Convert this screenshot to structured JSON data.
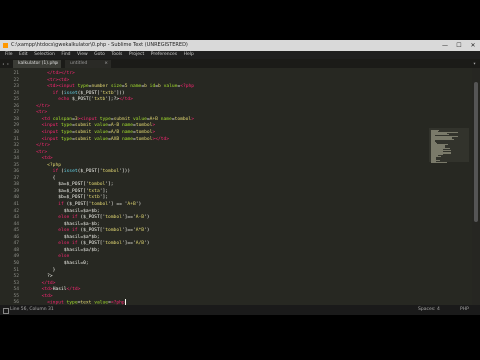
{
  "window": {
    "title": "C:\\xampp\\htdocs\\gwekalkulator\\0.php - Sublime Text (UNREGISTERED)",
    "minimize": "—",
    "maximize": "☐",
    "close": "✕"
  },
  "menu": [
    "File",
    "Edit",
    "Selection",
    "Find",
    "View",
    "Goto",
    "Tools",
    "Project",
    "Preferences",
    "Help"
  ],
  "tabs": [
    {
      "label": "kalkulator (1).php",
      "close": "×"
    },
    {
      "label": "untitled",
      "close": "×"
    }
  ],
  "tab_scroll": "◂ ▸",
  "tab_menu": "▾",
  "status": {
    "position": "Line 56, Column 31",
    "spaces": "Spaces: 4",
    "syntax": "PHP"
  },
  "code_lines": [
    {
      "n": "21",
      "parts": [
        [
          "t",
          "        "
        ],
        [
          "tag",
          "</td>"
        ],
        [
          "tag",
          "</tr>"
        ]
      ]
    },
    {
      "n": "22",
      "parts": [
        [
          "t",
          "        "
        ],
        [
          "tag",
          "<tr>"
        ],
        [
          "tag",
          "<td>"
        ]
      ]
    },
    {
      "n": "23",
      "parts": [
        [
          "t",
          "        "
        ],
        [
          "tag",
          "<td><input "
        ],
        [
          "attr",
          "type"
        ],
        [
          "t",
          "="
        ],
        [
          "str",
          "number"
        ],
        [
          "t",
          " "
        ],
        [
          "attr",
          "size"
        ],
        [
          "t",
          "="
        ],
        [
          "str",
          "5"
        ],
        [
          "t",
          " "
        ],
        [
          "attr",
          "name"
        ],
        [
          "t",
          "="
        ],
        [
          "str",
          "b"
        ],
        [
          "t",
          " "
        ],
        [
          "attr",
          "id"
        ],
        [
          "t",
          "="
        ],
        [
          "str",
          "b"
        ],
        [
          "t",
          " "
        ],
        [
          "attr",
          "value"
        ],
        [
          "t",
          "="
        ],
        [
          "tag",
          "<?php"
        ]
      ]
    },
    {
      "n": "24",
      "parts": [
        [
          "t",
          "          "
        ],
        [
          "kw",
          "if"
        ],
        [
          "t",
          " ("
        ],
        [
          "fn",
          "isset"
        ],
        [
          "t",
          "($_POST['"
        ],
        [
          "str",
          "txtb"
        ],
        [
          "t",
          "']))"
        ]
      ]
    },
    {
      "n": "25",
      "parts": [
        [
          "t",
          "            "
        ],
        [
          "kw",
          "echo"
        ],
        [
          "t",
          " $_POST['"
        ],
        [
          "str",
          "txtb"
        ],
        [
          "t",
          "'];?>"
        ],
        [
          "tag",
          "</td>"
        ]
      ]
    },
    {
      "n": "26",
      "parts": [
        [
          "t",
          "    "
        ],
        [
          "tag",
          "</tr>"
        ]
      ]
    },
    {
      "n": "27",
      "parts": [
        [
          "t",
          "    "
        ],
        [
          "tag",
          "<tr>"
        ]
      ]
    },
    {
      "n": "28",
      "parts": [
        [
          "t",
          "      "
        ],
        [
          "tag",
          "<td "
        ],
        [
          "attr",
          "colspan"
        ],
        [
          "t",
          "="
        ],
        [
          "str",
          "3"
        ],
        [
          "tag",
          "><input "
        ],
        [
          "attr",
          "type"
        ],
        [
          "t",
          "="
        ],
        [
          "str",
          "submit"
        ],
        [
          "t",
          " "
        ],
        [
          "attr",
          "value"
        ],
        [
          "t",
          "="
        ],
        [
          "str",
          "A+B"
        ],
        [
          "t",
          " "
        ],
        [
          "attr",
          "name"
        ],
        [
          "t",
          "="
        ],
        [
          "str",
          "tombol"
        ],
        [
          "tag",
          ">"
        ]
      ]
    },
    {
      "n": "29",
      "parts": [
        [
          "t",
          "      "
        ],
        [
          "tag",
          "<input "
        ],
        [
          "attr",
          "type"
        ],
        [
          "t",
          "="
        ],
        [
          "str",
          "submit"
        ],
        [
          "t",
          " "
        ],
        [
          "attr",
          "value"
        ],
        [
          "t",
          "="
        ],
        [
          "str",
          "A-B"
        ],
        [
          "t",
          " "
        ],
        [
          "attr",
          "name"
        ],
        [
          "t",
          "="
        ],
        [
          "str",
          "tombol"
        ],
        [
          "tag",
          ">"
        ]
      ]
    },
    {
      "n": "30",
      "parts": [
        [
          "t",
          "      "
        ],
        [
          "tag",
          "<input "
        ],
        [
          "attr",
          "type"
        ],
        [
          "t",
          "="
        ],
        [
          "str",
          "submit"
        ],
        [
          "t",
          " "
        ],
        [
          "attr",
          "value"
        ],
        [
          "t",
          "="
        ],
        [
          "str",
          "A/B"
        ],
        [
          "t",
          " "
        ],
        [
          "attr",
          "name"
        ],
        [
          "t",
          "="
        ],
        [
          "str",
          "tombol"
        ],
        [
          "tag",
          ">"
        ]
      ]
    },
    {
      "n": "31",
      "parts": [
        [
          "t",
          "      "
        ],
        [
          "tag",
          "<input "
        ],
        [
          "attr",
          "type"
        ],
        [
          "t",
          "="
        ],
        [
          "str",
          "submit"
        ],
        [
          "t",
          " "
        ],
        [
          "attr",
          "value"
        ],
        [
          "t",
          "="
        ],
        [
          "str",
          "AXB"
        ],
        [
          "t",
          " "
        ],
        [
          "attr",
          "name"
        ],
        [
          "t",
          "="
        ],
        [
          "str",
          "tombol"
        ],
        [
          "tag",
          "></td>"
        ]
      ]
    },
    {
      "n": "32",
      "parts": [
        [
          "t",
          "    "
        ],
        [
          "tag",
          "</tr>"
        ]
      ]
    },
    {
      "n": "33",
      "parts": [
        [
          "t",
          "    "
        ],
        [
          "tag",
          "<tr>"
        ]
      ]
    },
    {
      "n": "34",
      "parts": [
        [
          "t",
          "      "
        ],
        [
          "tag",
          "<td>"
        ]
      ]
    },
    {
      "n": "35",
      "parts": [
        [
          "t",
          "        "
        ],
        [
          "php",
          "<?php"
        ]
      ]
    },
    {
      "n": "36",
      "parts": [
        [
          "t",
          "          "
        ],
        [
          "kw",
          "if"
        ],
        [
          "t",
          " ("
        ],
        [
          "fn",
          "isset"
        ],
        [
          "t",
          "($_POST['"
        ],
        [
          "str",
          "tombol"
        ],
        [
          "t",
          "']))"
        ]
      ]
    },
    {
      "n": "37",
      "parts": [
        [
          "t",
          "          {"
        ]
      ]
    },
    {
      "n": "38",
      "parts": [
        [
          "t",
          "            "
        ],
        [
          "var",
          "$a=$_POST['"
        ],
        [
          "str",
          "tombol"
        ],
        [
          "t",
          "'];"
        ]
      ]
    },
    {
      "n": "39",
      "parts": [
        [
          "t",
          "            "
        ],
        [
          "var",
          "$a=$_POST['"
        ],
        [
          "str",
          "txta"
        ],
        [
          "t",
          "'];"
        ]
      ]
    },
    {
      "n": "40",
      "parts": [
        [
          "t",
          "            "
        ],
        [
          "var",
          "$b=$_POST['"
        ],
        [
          "str",
          "txtb"
        ],
        [
          "t",
          "'];"
        ]
      ]
    },
    {
      "n": "41",
      "parts": [
        [
          "t",
          "            "
        ],
        [
          "kw",
          "if"
        ],
        [
          "t",
          " ($_POST['"
        ],
        [
          "str",
          "tombol"
        ],
        [
          "t",
          "'] == '"
        ],
        [
          "str",
          "A+B"
        ],
        [
          "t",
          "')"
        ]
      ]
    },
    {
      "n": "42",
      "parts": [
        [
          "t",
          "              $hasil=$a+$b;"
        ]
      ]
    },
    {
      "n": "43",
      "parts": [
        [
          "t",
          "            "
        ],
        [
          "kw",
          "else if"
        ],
        [
          "t",
          " ($_POST['"
        ],
        [
          "str",
          "tombol"
        ],
        [
          "t",
          "']=='"
        ],
        [
          "str",
          "A-B"
        ],
        [
          "t",
          "')"
        ]
      ]
    },
    {
      "n": "44",
      "parts": [
        [
          "t",
          "              $hasil=$a-$b;"
        ]
      ]
    },
    {
      "n": "45",
      "parts": [
        [
          "t",
          "            "
        ],
        [
          "kw",
          "else if"
        ],
        [
          "t",
          " ($_POST['"
        ],
        [
          "str",
          "tombol"
        ],
        [
          "t",
          "']=='"
        ],
        [
          "str",
          "A*B"
        ],
        [
          "t",
          "')"
        ]
      ]
    },
    {
      "n": "46",
      "parts": [
        [
          "t",
          "              $hasil=$a*$b;"
        ]
      ]
    },
    {
      "n": "47",
      "parts": [
        [
          "t",
          "            "
        ],
        [
          "kw",
          "else if"
        ],
        [
          "t",
          " ($_POST['"
        ],
        [
          "str",
          "tombol"
        ],
        [
          "t",
          "']=='"
        ],
        [
          "str",
          "A/B"
        ],
        [
          "t",
          "')"
        ]
      ]
    },
    {
      "n": "48",
      "parts": [
        [
          "t",
          "              $hasil=$a/$b;"
        ]
      ]
    },
    {
      "n": "49",
      "parts": [
        [
          "t",
          "            "
        ],
        [
          "kw",
          "else"
        ]
      ]
    },
    {
      "n": "50",
      "parts": [
        [
          "t",
          "              $hasil=0;"
        ]
      ]
    },
    {
      "n": "51",
      "parts": [
        [
          "t",
          "          }"
        ]
      ]
    },
    {
      "n": "52",
      "parts": [
        [
          "t",
          "        ?>"
        ]
      ]
    },
    {
      "n": "53",
      "parts": [
        [
          "t",
          "      "
        ],
        [
          "tag",
          "</td>"
        ]
      ]
    },
    {
      "n": "54",
      "parts": [
        [
          "t",
          "      "
        ],
        [
          "tag",
          "<td>"
        ],
        [
          "t",
          "Hasil"
        ],
        [
          "tag",
          "</td>"
        ]
      ]
    },
    {
      "n": "55",
      "parts": [
        [
          "t",
          "      "
        ],
        [
          "tag",
          "<td>"
        ]
      ]
    },
    {
      "n": "56",
      "parts": [
        [
          "t",
          "        "
        ],
        [
          "tag",
          "<input "
        ],
        [
          "attr",
          "type"
        ],
        [
          "t",
          "="
        ],
        [
          "str",
          "text"
        ],
        [
          "t",
          " "
        ],
        [
          "attr",
          "value"
        ],
        [
          "t",
          "="
        ],
        [
          "tag",
          "<?php"
        ]
      ]
    }
  ],
  "colors": {
    "editor_bg": "#272822",
    "tag": "#f92672",
    "attr": "#a6e22e",
    "string": "#e6db74",
    "function": "#66d9ef"
  }
}
